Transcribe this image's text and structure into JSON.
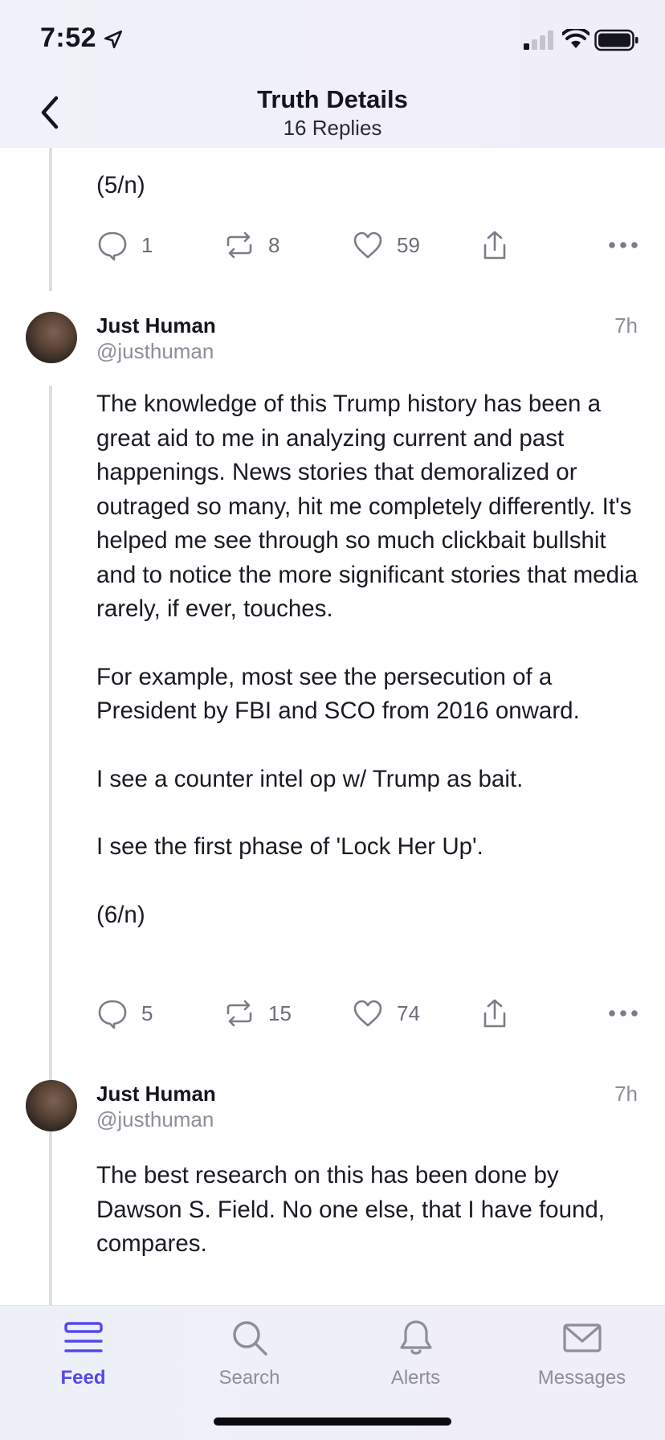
{
  "status_bar": {
    "time": "7:52"
  },
  "header": {
    "title": "Truth Details",
    "subtitle": "16 Replies"
  },
  "posts": [
    {
      "text_lines": [
        "(5/n)"
      ],
      "replies": "1",
      "retruths": "8",
      "likes": "59"
    },
    {
      "author": "Just Human",
      "handle": "@justhuman",
      "time": "7h",
      "paragraphs": [
        "The knowledge of this Trump history has been a great aid to me in analyzing current and past happenings. News stories that demoralized or outraged so many, hit me completely differently. It's helped me see through so much clickbait bullshit and to notice the more significant stories that media rarely, if ever, touches.",
        "For example, most see the persecution of a President by FBI and SCO from 2016 onward.",
        "I see a counter intel op w/ Trump as bait.",
        "I see the first phase of 'Lock Her Up'.",
        "(6/n)"
      ],
      "replies": "5",
      "retruths": "15",
      "likes": "74"
    },
    {
      "author": "Just Human",
      "handle": "@justhuman",
      "time": "7h",
      "paragraphs": [
        "The best research on this has been done by Dawson S. Field. No one else, that I have found, compares."
      ]
    }
  ],
  "tabs": [
    {
      "label": "Feed",
      "icon": "feed-icon",
      "active": true
    },
    {
      "label": "Search",
      "icon": "search-icon",
      "active": false
    },
    {
      "label": "Alerts",
      "icon": "bell-icon",
      "active": false
    },
    {
      "label": "Messages",
      "icon": "envelope-icon",
      "active": false
    }
  ],
  "colors": {
    "accent": "#5448ee",
    "muted": "#8e8e99",
    "icon": "#7c7c88"
  }
}
